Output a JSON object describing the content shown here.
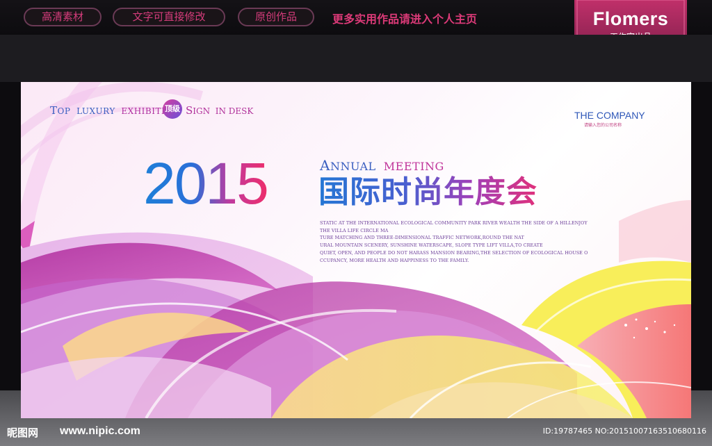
{
  "header": {
    "tags": [
      "高清素材",
      "文字可直接修改",
      "原创作品"
    ],
    "promo": "更多实用作品请进入个人主页",
    "brand": {
      "name": "Flomers",
      "sub": "工作室出品"
    }
  },
  "poster": {
    "tagline": {
      "top_cap": "T",
      "top_rest": "OP",
      "luxury": "LUXURY",
      "exhibition": "EXHIBITION",
      "badge": "顶级",
      "sign_cap": "S",
      "sign_rest": "IGN",
      "in_desk": "IN DESK"
    },
    "company": "THE COMPANY",
    "company_sub": "请输入您的公司名称",
    "year": "2015",
    "annual": {
      "cap": "A",
      "rest": "NNUAL",
      "meeting": "MEETING"
    },
    "title_cn": "国际时尚年度会",
    "paragraph": [
      "STATIC AT THE INTERNATIONAL ECOLOGICAL COMMUNITY PARK RIVER WEALTH THE SIDE OF A HILLENJOY",
      "THE VILLA LIFE CIRCLE MA",
      "TURE MATCHING AND THREE-DIMENSIONAL TRAFFIC NETWORK,ROUND THE NAT",
      "URAL MOUNTAIN SCENERY, SUNSHINE WATERSCAPE, SLOPE TYPE LIFT VILLA,TO CREATE",
      "QUIET, OPEN, AND PEOPLE DO NOT HARASS MANSION BEARING,THE SELECTION OF ECOLOGICAL HOUSE O",
      "CCUPANCY, MORE HEALTH AND HAPPINESS TO THE FAMILY."
    ]
  },
  "footer": {
    "logo": "昵图网",
    "url": "www.nipic.com",
    "id_text": "ID:19787465 NO:20151007163510680116"
  },
  "colors": {
    "accent_pink": "#dc3a78",
    "title_blue": "#2476d4",
    "title_magenta": "#e0307a",
    "background_dark": "#0d0c0f"
  }
}
